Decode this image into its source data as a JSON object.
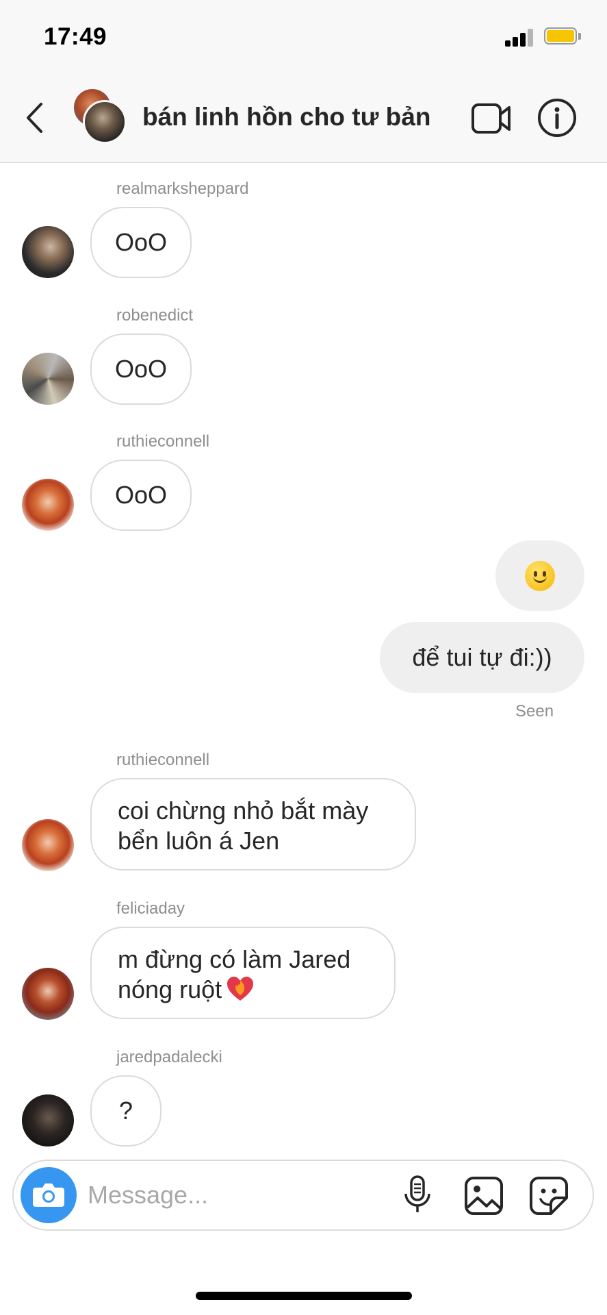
{
  "status_bar": {
    "time": "17:49",
    "battery_color": "#f5c500"
  },
  "header": {
    "back_icon": "chevron-left-icon",
    "title": "bán linh hồn cho tư bản",
    "video_icon": "video-camera-icon",
    "info_icon": "info-icon"
  },
  "messages": [
    {
      "sender": "realmarksheppard",
      "text": "OoO"
    },
    {
      "sender": "robenedict",
      "text": "OoO"
    },
    {
      "sender": "ruthieconnell",
      "text": "OoO"
    },
    {
      "sender": "ruthieconnell",
      "text": "coi chừng nhỏ bắt mày bển luôn á Jen"
    },
    {
      "sender": "feliciaday",
      "text": "m đừng có làm Jared nóng ruột"
    },
    {
      "sender": "jaredpadalecki",
      "text": "?"
    }
  ],
  "outgoing": [
    {
      "emoji": "slightly-smiling-face-icon"
    },
    {
      "text": "để tui tự đi:))"
    }
  ],
  "seen_label": "Seen",
  "composer": {
    "placeholder": "Message...",
    "camera_icon": "camera-icon",
    "mic_icon": "microphone-icon",
    "gallery_icon": "gallery-icon",
    "sticker_icon": "sticker-icon",
    "accent_color": "#3797f0"
  }
}
